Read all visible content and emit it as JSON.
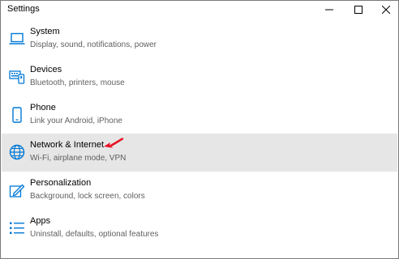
{
  "window": {
    "title": "Settings",
    "controls": {
      "minimize": "minimize-icon",
      "maximize": "maximize-icon",
      "close": "close-icon"
    }
  },
  "colors": {
    "accent": "#0078d7",
    "selected_row": "#e6e6e6",
    "annotation_arrow": "#e81123"
  },
  "items": [
    {
      "name": "System",
      "desc": "Display, sound, notifications, power",
      "icon": "laptop-icon"
    },
    {
      "name": "Devices",
      "desc": "Bluetooth, printers, mouse",
      "icon": "keyboard-icon"
    },
    {
      "name": "Phone",
      "desc": "Link your Android, iPhone",
      "icon": "phone-icon"
    },
    {
      "name": "Network & Internet",
      "desc": "Wi-Fi, airplane mode, VPN",
      "icon": "globe-icon",
      "selected": true
    },
    {
      "name": "Personalization",
      "desc": "Background, lock screen, colors",
      "icon": "pen-icon"
    },
    {
      "name": "Apps",
      "desc": "Uninstall, defaults, optional features",
      "icon": "apps-list-icon"
    }
  ]
}
